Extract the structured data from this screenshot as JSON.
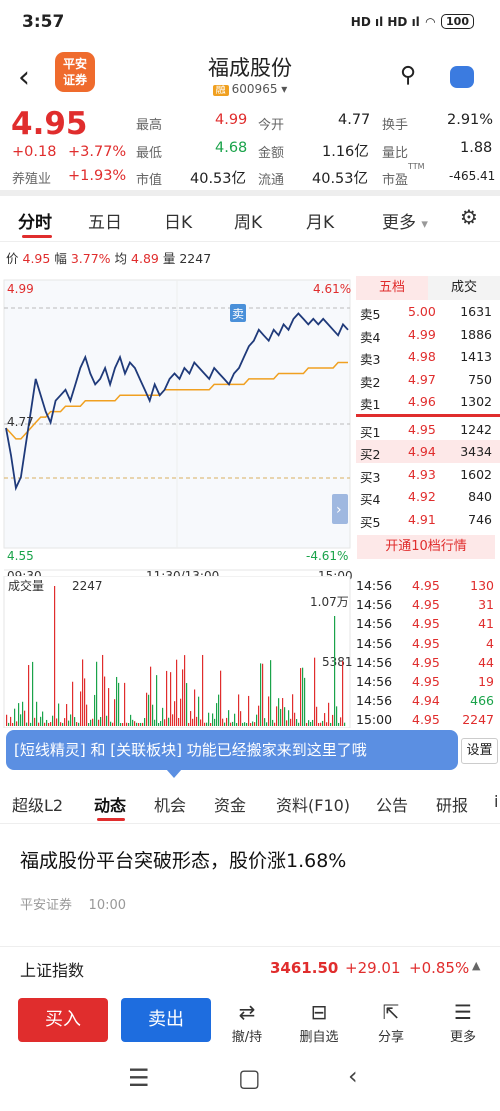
{
  "status": {
    "time": "3:57",
    "signal": "HD ıl HD ıl",
    "battery": "100"
  },
  "header": {
    "logo": "平安\n证券",
    "name": "福成股份",
    "rong": "融",
    "code": "600965"
  },
  "quote": {
    "price": "4.95",
    "change": "+0.18",
    "change_pct": "+3.77%",
    "sector": "养殖业",
    "sector_pct": "+1.93%",
    "l_high": "最高",
    "v_high": "4.99",
    "l_low": "最低",
    "v_low": "4.68",
    "l_mcap": "市值",
    "v_mcap": "40.53亿",
    "l_open": "今开",
    "v_open": "4.77",
    "l_amt": "金额",
    "v_amt": "1.16亿",
    "l_float": "流通",
    "v_float": "40.53亿",
    "l_turn": "换手",
    "v_turn": "2.91%",
    "l_vr": "量比",
    "v_vr": "1.88",
    "l_pe": "市盈",
    "pe_sup": "TTM",
    "v_pe": "-465.41"
  },
  "tabs": [
    "分时",
    "五日",
    "日K",
    "周K",
    "月K",
    "更多"
  ],
  "info": {
    "l_price": "价",
    "price": "4.95",
    "l_fu": "幅",
    "fu": "3.77%",
    "l_jun": "均",
    "jun": "4.89",
    "l_liang": "量",
    "liang": "2247"
  },
  "chart_data": {
    "type": "line",
    "top_left": "4.99",
    "top_right": "4.61%",
    "mid": "4.77",
    "bot_left": "4.55",
    "bot_right": "-4.61%",
    "x_ticks": [
      "09:30",
      "11:30/13:00",
      "15:00"
    ],
    "marker": "卖",
    "ylim": [
      4.55,
      4.99
    ],
    "price": [
      4.77,
      4.72,
      4.66,
      4.68,
      4.74,
      4.8,
      4.86,
      4.83,
      4.8,
      4.78,
      4.82,
      4.83,
      4.84,
      4.82,
      4.85,
      4.88,
      4.9,
      4.87,
      4.85,
      4.86,
      4.88,
      4.85,
      4.88,
      4.9,
      4.87,
      4.89,
      4.88,
      4.86,
      4.84,
      4.82,
      4.85,
      4.83,
      4.84,
      4.86,
      4.87,
      4.86,
      4.88,
      4.87,
      4.89,
      4.88,
      4.87,
      4.86,
      4.88,
      4.87,
      4.86,
      4.85,
      4.87,
      4.88,
      4.9,
      4.92,
      4.93,
      4.95,
      4.94,
      4.93,
      4.95,
      4.94,
      4.96,
      4.95,
      4.97,
      4.98,
      4.97,
      4.96,
      4.97,
      4.96,
      4.97,
      4.96,
      4.95,
      4.94,
      4.96,
      4.95
    ],
    "avg": [
      4.77,
      4.76,
      4.75,
      4.75,
      4.76,
      4.77,
      4.78,
      4.79,
      4.79,
      4.8,
      4.8,
      4.8,
      4.81,
      4.81,
      4.81,
      4.81,
      4.82,
      4.82,
      4.82,
      4.82,
      4.82,
      4.82,
      4.82,
      4.83,
      4.83,
      4.83,
      4.83,
      4.83,
      4.83,
      4.83,
      4.83,
      4.83,
      4.84,
      4.84,
      4.84,
      4.84,
      4.84,
      4.84,
      4.84,
      4.84,
      4.84,
      4.84,
      4.85,
      4.85,
      4.85,
      4.85,
      4.85,
      4.85,
      4.85,
      4.86,
      4.86,
      4.86,
      4.86,
      4.86,
      4.86,
      4.87,
      4.87,
      4.87,
      4.87,
      4.87,
      4.87,
      4.88,
      4.88,
      4.88,
      4.88,
      4.88,
      4.88,
      4.89,
      4.89,
      4.89
    ],
    "vol_label": "成交量",
    "vol_value": "2247",
    "vol_max": "1.07万",
    "vol_mid": "5381"
  },
  "orderbook": {
    "h1": "五档",
    "h2": "成交",
    "asks": [
      {
        "l": "卖5",
        "p": "5.00",
        "v": "1631"
      },
      {
        "l": "卖4",
        "p": "4.99",
        "v": "1886"
      },
      {
        "l": "卖3",
        "p": "4.98",
        "v": "1413"
      },
      {
        "l": "卖2",
        "p": "4.97",
        "v": "750"
      },
      {
        "l": "卖1",
        "p": "4.96",
        "v": "1302"
      }
    ],
    "bids": [
      {
        "l": "买1",
        "p": "4.95",
        "v": "1242"
      },
      {
        "l": "买2",
        "p": "4.94",
        "v": "3434"
      },
      {
        "l": "买3",
        "p": "4.93",
        "v": "1602"
      },
      {
        "l": "买4",
        "p": "4.92",
        "v": "840"
      },
      {
        "l": "买5",
        "p": "4.91",
        "v": "746"
      }
    ],
    "kaitong": "开通10档行情"
  },
  "trades": [
    {
      "t": "14:56",
      "p": "4.95",
      "v": "130"
    },
    {
      "t": "14:56",
      "p": "4.95",
      "v": "31"
    },
    {
      "t": "14:56",
      "p": "4.95",
      "v": "41"
    },
    {
      "t": "14:56",
      "p": "4.95",
      "v": "4"
    },
    {
      "t": "14:56",
      "p": "4.95",
      "v": "44"
    },
    {
      "t": "14:56",
      "p": "4.95",
      "v": "19"
    },
    {
      "t": "14:56",
      "p": "4.94",
      "v": "466"
    },
    {
      "t": "15:00",
      "p": "4.95",
      "v": "2247"
    }
  ],
  "tooltip": "[短线精灵] 和 [关联板块] 功能已经搬家来到这里了哦",
  "settings": "设置",
  "subtabs": [
    "超级L2",
    "动态",
    "机会",
    "资金",
    "资料(F10)",
    "公告",
    "研报",
    "i"
  ],
  "news": {
    "title": "福成股份平台突破形态，股价涨1.68%",
    "source": "平安证券",
    "time": "10:00"
  },
  "index": {
    "name": "上证指数",
    "value": "3461.50",
    "change": "+29.01",
    "pct": "+0.85%"
  },
  "bottom": {
    "buy": "买入",
    "sell": "卖出",
    "b1": "撤/持",
    "b2": "删自选",
    "b3": "分享",
    "b4": "更多"
  },
  "colors": {
    "up": "#e02d2d",
    "down": "#1aa34a",
    "price_line": "#1f3a7a",
    "avg_line": "#f0a020",
    "tooltip": "#5b8fe2"
  }
}
